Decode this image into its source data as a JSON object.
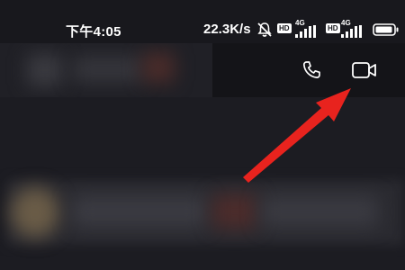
{
  "status_bar": {
    "time": "下午4:05",
    "net_speed": "22.3K/s",
    "sim1_label": "HD",
    "sim1_network": "4G",
    "sim2_label": "HD",
    "sim2_network": "4G",
    "icons": [
      "mute-icon",
      "signal-icon",
      "battery-icon"
    ]
  },
  "chat_header": {
    "actions": [
      "phone-icon",
      "video-call-icon"
    ]
  },
  "annotation": {
    "type": "red-arrow",
    "points_to": "video-call-button",
    "color": "#e8231e"
  },
  "colors": {
    "background": "#1b1b21",
    "header_right": "#141418",
    "icon": "#ffffff",
    "arrow": "#e8231e"
  }
}
